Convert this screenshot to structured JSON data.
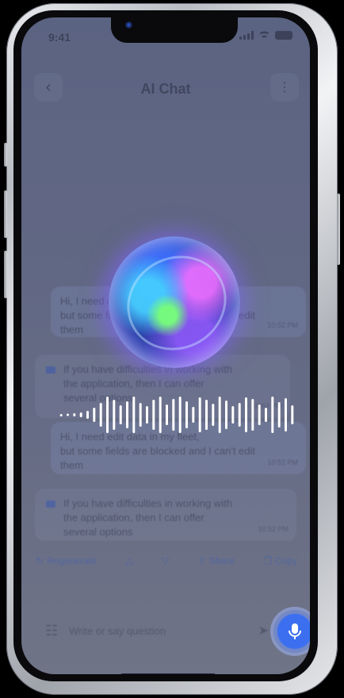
{
  "status_bar": {
    "time": "9:41"
  },
  "header": {
    "title": "AI Chat",
    "back_icon": "chevron-left-icon",
    "menu_icon": "more-vertical-icon"
  },
  "messages": [
    {
      "role": "user",
      "lines": [
        "Hi, I need edit data in my fleet,",
        "but some fields are blocked and I can't edit",
        "them"
      ],
      "time": "10:52 PM"
    },
    {
      "role": "assistant",
      "lines": [
        "If you have difficulties in working with",
        "the application, then I can offer",
        "several options"
      ],
      "time": "10:52 PM"
    },
    {
      "role": "user",
      "lines": [
        "Hi, I need edit data in my fleet,",
        "but some fields are blocked and I can't edit",
        "them"
      ],
      "time": "10:52 PM"
    },
    {
      "role": "assistant",
      "lines": [
        "If you have difficulties in working with",
        "the application, then I can offer",
        "several options"
      ],
      "time": "10:52 PM"
    }
  ],
  "actions": {
    "regenerate": "Regenerate",
    "share": "Share",
    "copy": "Copy"
  },
  "input": {
    "placeholder": "Write or say question"
  },
  "colors": {
    "accent": "#3b6ff0",
    "bg": "#656b86"
  },
  "voice_overlay": {
    "state": "listening"
  }
}
